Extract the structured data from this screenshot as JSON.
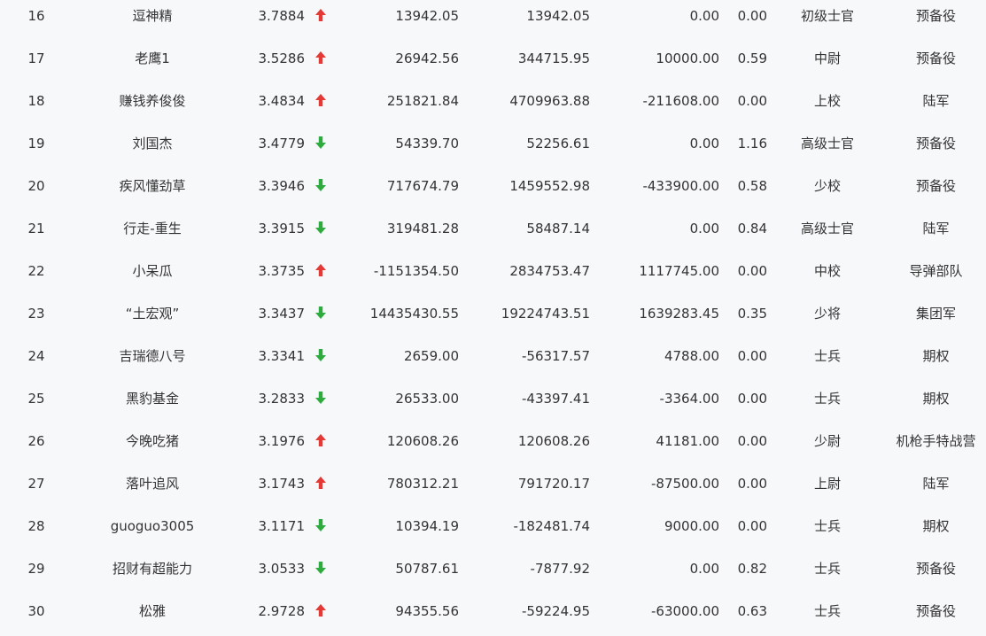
{
  "colors": {
    "up": "#e53935",
    "down": "#2eab3f",
    "text": "#333333",
    "background": "#f7f8fa"
  },
  "rows": [
    {
      "rank": "16",
      "name": "逗神精",
      "score": "3.7884",
      "trend": "up",
      "v1": "13942.05",
      "v2": "13942.05",
      "v3": "0.00",
      "pct": "0.00",
      "level": "初级士官",
      "unit": "预备役"
    },
    {
      "rank": "17",
      "name": "老鹰1",
      "score": "3.5286",
      "trend": "up",
      "v1": "26942.56",
      "v2": "344715.95",
      "v3": "10000.00",
      "pct": "0.59",
      "level": "中尉",
      "unit": "预备役"
    },
    {
      "rank": "18",
      "name": "赚钱养俊俊",
      "score": "3.4834",
      "trend": "up",
      "v1": "251821.84",
      "v2": "4709963.88",
      "v3": "-211608.00",
      "pct": "0.00",
      "level": "上校",
      "unit": "陆军"
    },
    {
      "rank": "19",
      "name": "刘国杰",
      "score": "3.4779",
      "trend": "down",
      "v1": "54339.70",
      "v2": "52256.61",
      "v3": "0.00",
      "pct": "1.16",
      "level": "高级士官",
      "unit": "预备役"
    },
    {
      "rank": "20",
      "name": "疾风懂劲草",
      "score": "3.3946",
      "trend": "down",
      "v1": "717674.79",
      "v2": "1459552.98",
      "v3": "-433900.00",
      "pct": "0.58",
      "level": "少校",
      "unit": "预备役"
    },
    {
      "rank": "21",
      "name": "行走-重生",
      "score": "3.3915",
      "trend": "down",
      "v1": "319481.28",
      "v2": "58487.14",
      "v3": "0.00",
      "pct": "0.84",
      "level": "高级士官",
      "unit": "陆军"
    },
    {
      "rank": "22",
      "name": "小呆瓜",
      "score": "3.3735",
      "trend": "up",
      "v1": "-1151354.50",
      "v2": "2834753.47",
      "v3": "1117745.00",
      "pct": "0.00",
      "level": "中校",
      "unit": "导弹部队"
    },
    {
      "rank": "23",
      "name": "“土宏观”",
      "score": "3.3437",
      "trend": "down",
      "v1": "14435430.55",
      "v2": "19224743.51",
      "v3": "1639283.45",
      "pct": "0.35",
      "level": "少将",
      "unit": "集团军"
    },
    {
      "rank": "24",
      "name": "吉瑞德八号",
      "score": "3.3341",
      "trend": "down",
      "v1": "2659.00",
      "v2": "-56317.57",
      "v3": "4788.00",
      "pct": "0.00",
      "level": "士兵",
      "unit": "期权"
    },
    {
      "rank": "25",
      "name": "黑豹基金",
      "score": "3.2833",
      "trend": "down",
      "v1": "26533.00",
      "v2": "-43397.41",
      "v3": "-3364.00",
      "pct": "0.00",
      "level": "士兵",
      "unit": "期权"
    },
    {
      "rank": "26",
      "name": "今晚吃猪",
      "score": "3.1976",
      "trend": "up",
      "v1": "120608.26",
      "v2": "120608.26",
      "v3": "41181.00",
      "pct": "0.00",
      "level": "少尉",
      "unit": "机枪手特战营"
    },
    {
      "rank": "27",
      "name": "落叶追风",
      "score": "3.1743",
      "trend": "up",
      "v1": "780312.21",
      "v2": "791720.17",
      "v3": "-87500.00",
      "pct": "0.00",
      "level": "上尉",
      "unit": "陆军"
    },
    {
      "rank": "28",
      "name": "guoguo3005",
      "score": "3.1171",
      "trend": "down",
      "v1": "10394.19",
      "v2": "-182481.74",
      "v3": "9000.00",
      "pct": "0.00",
      "level": "士兵",
      "unit": "期权"
    },
    {
      "rank": "29",
      "name": "招财有超能力",
      "score": "3.0533",
      "trend": "down",
      "v1": "50787.61",
      "v2": "-7877.92",
      "v3": "0.00",
      "pct": "0.82",
      "level": "士兵",
      "unit": "预备役"
    },
    {
      "rank": "30",
      "name": "松雅",
      "score": "2.9728",
      "trend": "up",
      "v1": "94355.56",
      "v2": "-59224.95",
      "v3": "-63000.00",
      "pct": "0.63",
      "level": "士兵",
      "unit": "预备役"
    }
  ]
}
